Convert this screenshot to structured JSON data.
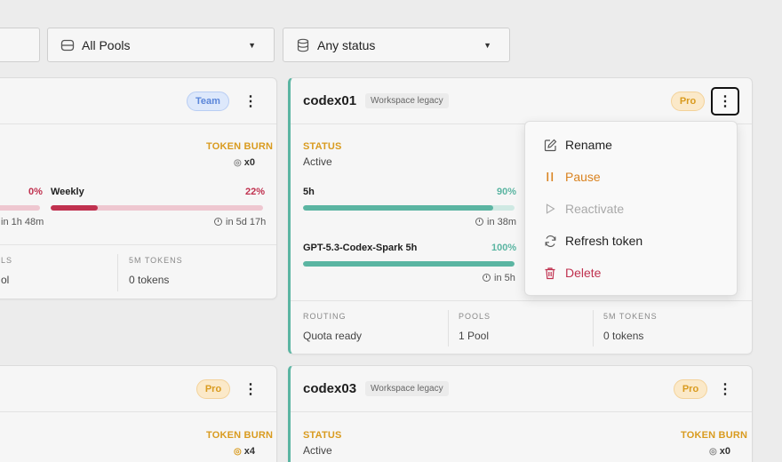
{
  "filters": {
    "pool": "All Pools",
    "status": "Any status"
  },
  "colors": {
    "accent_teal": "#5bb5a2",
    "orange": "#d99b1f",
    "red": "#c0314f"
  },
  "left_card_1": {
    "badge": "Team",
    "token_burn_label": "TOKEN BURN",
    "token_burn_value": "x0",
    "bar1_pct": "0%",
    "bar1_reset": "in 1h 48m",
    "bar2_label": "Weekly",
    "bar2_pct": "22%",
    "bar2_fill": 0.22,
    "bar2_reset": "in 5d 17h",
    "foot_col1_title": "LS",
    "foot_col1_value": "ol",
    "foot_col2_title": "5M TOKENS",
    "foot_col2_value": "0 tokens"
  },
  "left_card_2": {
    "badge": "Pro",
    "token_burn_label": "TOKEN BURN",
    "token_burn_value": "x4"
  },
  "card_codex01": {
    "name": "codex01",
    "tag": "Workspace legacy",
    "badge": "Pro",
    "status_label": "STATUS",
    "status_value": "Active",
    "bar1_label": "5h",
    "bar1_pct": "90%",
    "bar1_fill": 0.9,
    "bar1_reset": "in 38m",
    "bar2_label": "GPT-5.3-Codex-Spark 5h",
    "bar2_pct": "100%",
    "bar2_fill": 1.0,
    "bar2_reset": "in 5h",
    "foot": [
      {
        "title": "ROUTING",
        "value": "Quota ready"
      },
      {
        "title": "POOLS",
        "value": "1 Pool"
      },
      {
        "title": "5M TOKENS",
        "value": "0 tokens"
      }
    ]
  },
  "card_codex03": {
    "name": "codex03",
    "tag": "Workspace legacy",
    "badge": "Pro",
    "status_label": "STATUS",
    "status_value": "Active",
    "token_burn_label": "TOKEN BURN",
    "token_burn_value": "x0"
  },
  "menu": {
    "items": [
      {
        "label": "Rename",
        "icon": "pencil-icon"
      },
      {
        "label": "Pause",
        "icon": "pause-icon"
      },
      {
        "label": "Reactivate",
        "icon": "play-icon"
      },
      {
        "label": "Refresh token",
        "icon": "refresh-icon"
      },
      {
        "label": "Delete",
        "icon": "trash-icon"
      }
    ]
  }
}
